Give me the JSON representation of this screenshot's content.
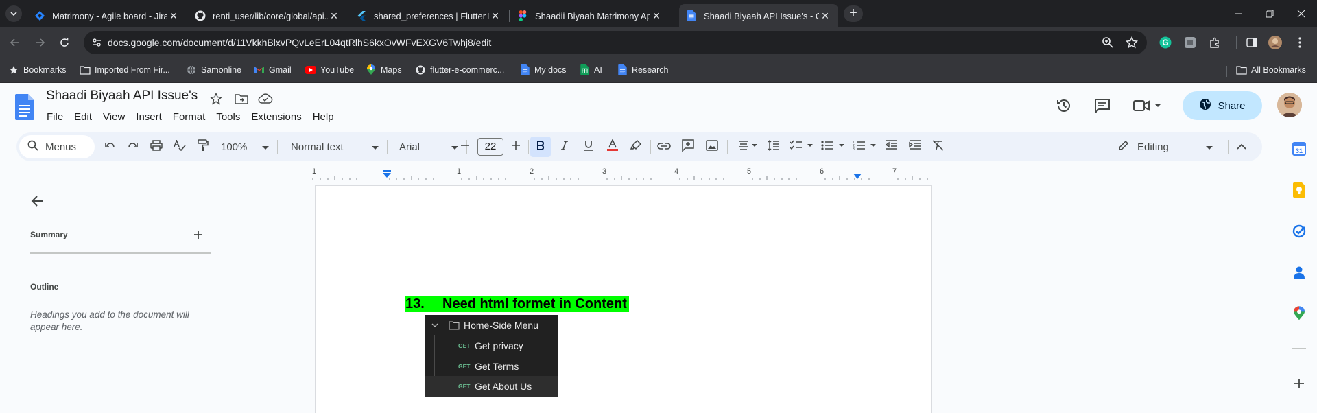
{
  "browser": {
    "tabs": [
      {
        "title": "Matrimony - Agile board - Jira",
        "favicon": "jira-icon",
        "active": false
      },
      {
        "title": "renti_user/lib/core/global/api...",
        "favicon": "github-icon",
        "active": false
      },
      {
        "title": "shared_preferences | Flutter Pa...",
        "favicon": "flutter-icon",
        "active": false
      },
      {
        "title": "Shaadii Biyaah Matrimony App...",
        "favicon": "figma-icon",
        "active": false
      },
      {
        "title": "Shaadi Biyaah API Issue's - Goo...",
        "favicon": "docs-icon",
        "active": true
      }
    ],
    "url": "docs.google.com/document/d/11VkkhBlxvPQvLeErL04qtRlhS6kxOvWFvEXGV6Twhj8/edit",
    "bookmarks": [
      {
        "label": "Bookmarks",
        "icon": "star-icon"
      },
      {
        "label": "Imported From Fir...",
        "icon": "folder-icon"
      },
      {
        "label": "Samonline",
        "icon": "globe-icon"
      },
      {
        "label": "Gmail",
        "icon": "gmail-icon"
      },
      {
        "label": "YouTube",
        "icon": "youtube-icon"
      },
      {
        "label": "Maps",
        "icon": "maps-icon"
      },
      {
        "label": "flutter-e-commerc...",
        "icon": "github-icon"
      },
      {
        "label": "My docs",
        "icon": "docs-icon"
      },
      {
        "label": "AI",
        "icon": "sheets-icon"
      },
      {
        "label": "Research",
        "icon": "docs-icon"
      }
    ],
    "all_bookmarks": "All Bookmarks"
  },
  "docs": {
    "title": "Shaadi Biyaah API Issue's",
    "menu": [
      "File",
      "Edit",
      "View",
      "Insert",
      "Format",
      "Tools",
      "Extensions",
      "Help"
    ],
    "share_label": "Share",
    "toolbar": {
      "search_menus": "Menus",
      "zoom": "100%",
      "style": "Normal text",
      "font": "Arial",
      "font_size": "22",
      "mode": "Editing"
    },
    "ruler_numbers": [
      "1",
      "1",
      "2",
      "3",
      "4",
      "5",
      "6",
      "7"
    ],
    "side_panel": {
      "summary": "Summary",
      "outline": "Outline",
      "outline_hint": "Headings you add to the document will appear here."
    },
    "content": {
      "heading_number": "13.",
      "heading_text": "Need html formet in Content",
      "highlight_color": "#00ff00",
      "postman": {
        "folder": "Home-Side Menu",
        "requests": [
          {
            "method": "GET",
            "name": "Get privacy"
          },
          {
            "method": "GET",
            "name": "Get Terms"
          },
          {
            "method": "GET",
            "name": "Get About Us"
          }
        ]
      }
    }
  },
  "colors": {
    "share_bg": "#c2e7ff",
    "docs_blue": "#4285f4",
    "text_color_underline": "#e53935"
  }
}
